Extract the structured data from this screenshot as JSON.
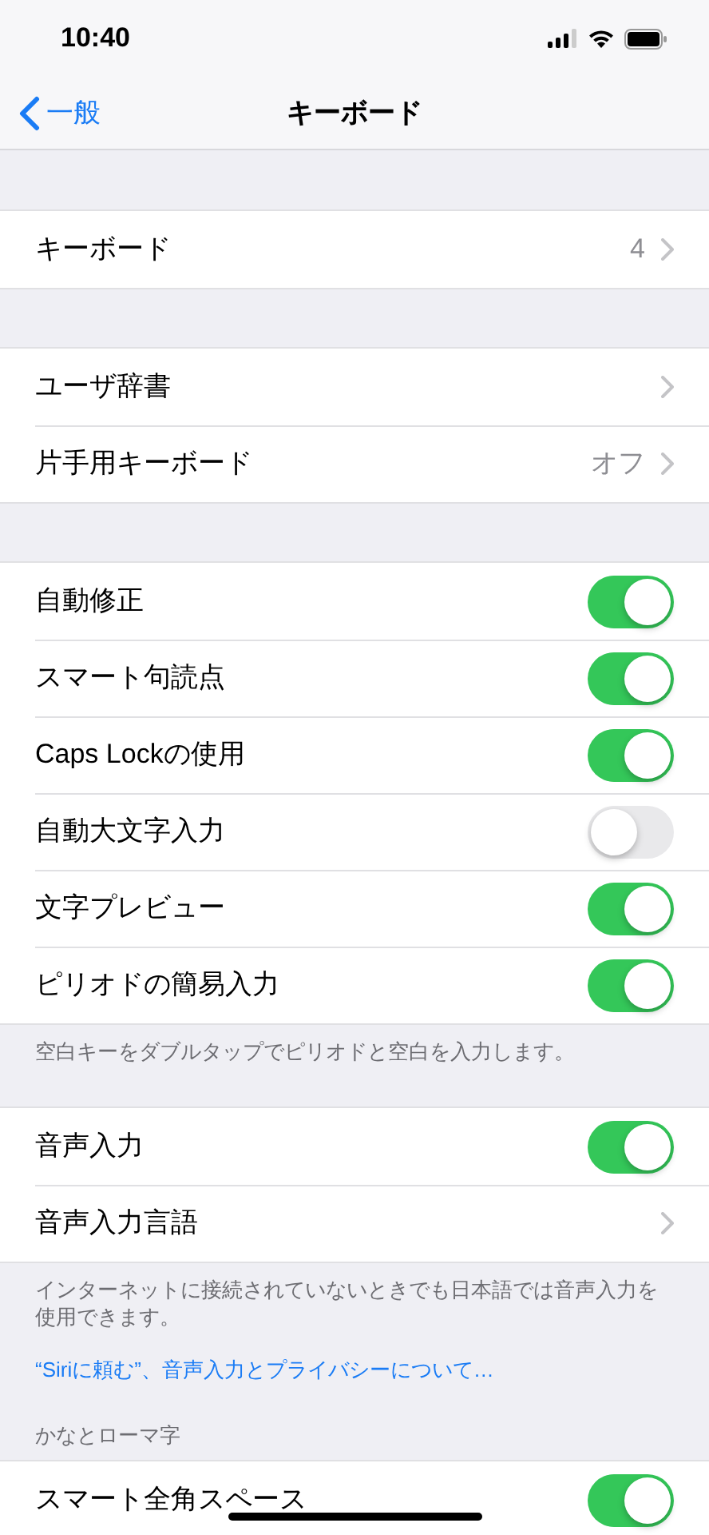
{
  "status_bar": {
    "time": "10:40"
  },
  "nav": {
    "back": "一般",
    "title": "キーボード"
  },
  "sections": [
    {
      "rows": [
        {
          "kind": "disclosure",
          "label": "キーボード",
          "value": "4"
        }
      ]
    },
    {
      "rows": [
        {
          "kind": "disclosure",
          "label": "ユーザ辞書"
        },
        {
          "kind": "disclosure",
          "label": "片手用キーボード",
          "value": "オフ"
        }
      ]
    },
    {
      "rows": [
        {
          "kind": "toggle",
          "label": "自動修正",
          "on": true
        },
        {
          "kind": "toggle",
          "label": "スマート句読点",
          "on": true
        },
        {
          "kind": "toggle",
          "label": "Caps Lockの使用",
          "on": true
        },
        {
          "kind": "toggle",
          "label": "自動大文字入力",
          "on": false
        },
        {
          "kind": "toggle",
          "label": "文字プレビュー",
          "on": true
        },
        {
          "kind": "toggle",
          "label": "ピリオドの簡易入力",
          "on": true
        }
      ],
      "footer": [
        {
          "kind": "text",
          "text": "空白キーをダブルタップでピリオドと空白を入力します。"
        }
      ]
    },
    {
      "rows": [
        {
          "kind": "toggle",
          "label": "音声入力",
          "on": true
        },
        {
          "kind": "disclosure",
          "label": "音声入力言語"
        }
      ],
      "footer": [
        {
          "kind": "text",
          "text": "インターネットに接続されていないときでも日本語では音声入力を使用できます。"
        },
        {
          "kind": "link",
          "text": "“Siriに頼む”、音声入力とプライバシーについて…"
        }
      ]
    },
    {
      "header": "かなとローマ字",
      "rows": [
        {
          "kind": "toggle",
          "label": "スマート全角スペース",
          "on": true
        }
      ]
    }
  ]
}
